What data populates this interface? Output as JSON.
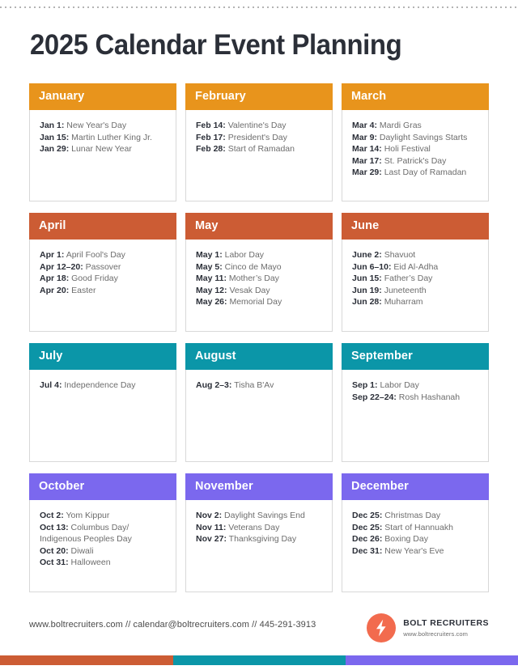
{
  "page": {
    "title": "2025 Calendar Event Planning"
  },
  "colors": {
    "orange": "#E8941C",
    "terracotta": "#CC5C34",
    "teal": "#0B96A8",
    "purple": "#7B68EE",
    "coral": "#F26B4E",
    "text_dark": "#2b2f38",
    "text_muted": "#6d6d6d"
  },
  "rows": [
    {
      "accent": "#E8941C",
      "months": [
        {
          "name": "January",
          "events": [
            {
              "date": "Jan 1",
              "event": "New Year's Day"
            },
            {
              "date": "Jan 15",
              "event": "Martin Luther King Jr."
            },
            {
              "date": "Jan 29",
              "event": "Lunar New Year"
            }
          ]
        },
        {
          "name": "February",
          "events": [
            {
              "date": "Feb 14",
              "event": "Valentine's Day"
            },
            {
              "date": "Feb 17",
              "event": "President's Day"
            },
            {
              "date": "Feb 28",
              "event": "Start of Ramadan"
            }
          ]
        },
        {
          "name": "March",
          "events": [
            {
              "date": "Mar 4",
              "event": "Mardi Gras"
            },
            {
              "date": "Mar 9",
              "event": "Daylight Savings Starts"
            },
            {
              "date": "Mar 14",
              "event": "Holi Festival"
            },
            {
              "date": "Mar 17",
              "event": "St. Patrick's Day"
            },
            {
              "date": "Mar 29",
              "event": "Last Day of Ramadan"
            }
          ]
        }
      ]
    },
    {
      "accent": "#CC5C34",
      "months": [
        {
          "name": "April",
          "events": [
            {
              "date": "Apr 1",
              "event": "April Fool's Day"
            },
            {
              "date": "Apr 12–20",
              "event": "Passover"
            },
            {
              "date": "Apr 18",
              "event": "Good Friday"
            },
            {
              "date": "Apr 20",
              "event": "Easter"
            }
          ]
        },
        {
          "name": "May",
          "events": [
            {
              "date": "May 1",
              "event": "Labor Day"
            },
            {
              "date": "May 5",
              "event": "Cinco de Mayo"
            },
            {
              "date": "May 11",
              "event": "Mother’s Day"
            },
            {
              "date": "May 12",
              "event": "Vesak Day"
            },
            {
              "date": "May 26",
              "event": "Memorial Day"
            }
          ]
        },
        {
          "name": "June",
          "events": [
            {
              "date": "June 2",
              "event": "Shavuot"
            },
            {
              "date": "Jun 6–10",
              "event": "Eid Al-Adha"
            },
            {
              "date": "Jun 15",
              "event": "Father’s Day"
            },
            {
              "date": "Jun 19",
              "event": "Juneteenth"
            },
            {
              "date": "Jun 28",
              "event": "Muharram"
            }
          ]
        }
      ]
    },
    {
      "accent": "#0B96A8",
      "months": [
        {
          "name": "July",
          "events": [
            {
              "date": "Jul 4",
              "event": "Independence  Day"
            }
          ]
        },
        {
          "name": "August",
          "events": [
            {
              "date": "Aug 2–3",
              "event": "Tisha B'Av"
            }
          ]
        },
        {
          "name": "September",
          "events": [
            {
              "date": "Sep 1",
              "event": "Labor Day"
            },
            {
              "date": "Sep 22–24",
              "event": "Rosh Hashanah"
            }
          ]
        }
      ]
    },
    {
      "accent": "#7B68EE",
      "months": [
        {
          "name": "October",
          "events": [
            {
              "date": "Oct 2",
              "event": "Yom Kippur"
            },
            {
              "date": "Oct 13",
              "event": "Columbus Day/ Indigenous Peoples Day"
            },
            {
              "date": "Oct 20",
              "event": "Diwali"
            },
            {
              "date": "Oct 31",
              "event": "Halloween"
            }
          ]
        },
        {
          "name": "November",
          "events": [
            {
              "date": "Nov 2",
              "event": "Daylight Savings End"
            },
            {
              "date": "Nov 11",
              "event": "Veterans Day"
            },
            {
              "date": "Nov 27",
              "event": "Thanksgiving Day"
            }
          ]
        },
        {
          "name": "December",
          "events": [
            {
              "date": "Dec 25",
              "event": "Christmas Day"
            },
            {
              "date": "Dec 25",
              "event": "Start of Hannuakh"
            },
            {
              "date": "Dec 26",
              "event": "Boxing Day"
            },
            {
              "date": "Dec 31",
              "event": "New Year's Eve"
            }
          ]
        }
      ]
    }
  ],
  "footer": {
    "contact": "www.boltrecruiters.com // calendar@boltrecruiters.com // 445-291-3913",
    "brand_name": "BOLT RECRUITERS",
    "brand_url": "www.boltrecruiters.com"
  },
  "bottom_bar": {
    "segments": [
      "#CC5C34",
      "#0B96A8",
      "#7B68EE"
    ]
  }
}
